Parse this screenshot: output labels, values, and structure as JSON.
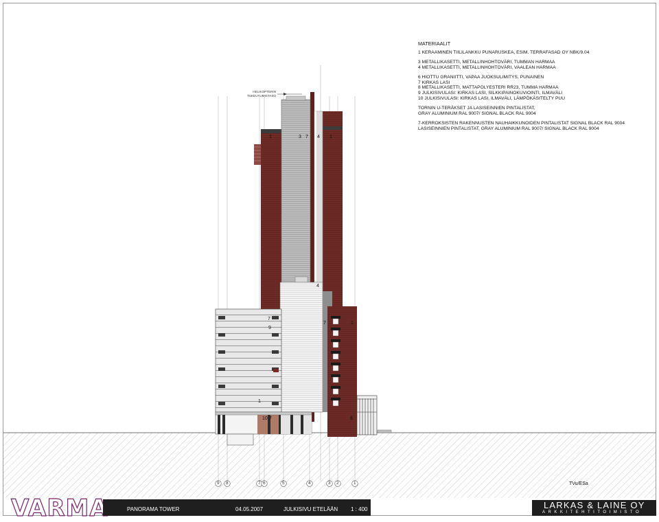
{
  "notes": {
    "title": "MATERIAALIT",
    "groups": [
      [
        "1   KERAAMINEN TIILILANKKU PUNARUSKEA, ESIM. TERRAFASAD OY NBK/9.04"
      ],
      [
        "3   METALLIKASETTI, METALLINHOHTOVÄRI, TUMMAN HARMAA",
        "4   METALLIKASETTI, METALLINHOHTOVÄRI, VAALEAN HARMAA"
      ],
      [
        "6   HIOTTU GRANIITTI, VAPAA JUOKSULIMITYS, PUNAINEN",
        "7   KIRKAS LASI",
        "8   METALLIKASETTI, MATTAPOLYESTERI RR23, TUMMA HARMAA",
        "9   JULKISIVULASI: KIRKAS LASI, SILKKIPAINOKUVIOINTI, ILMAVÄLI",
        "10 JULKISIVULASI: KIRKAS LASI,  ILMAVÄLI, LÄMPÖKÄSITELTY PUU"
      ],
      [
        "TORNIN U-TERÄKSET JA LASISEINNIEN PINTALISTAT,",
        "GRAY ALUMINIUM RAL 9007/ SIGNAL BLACK RAL 9004"
      ],
      [
        "7-KERROKSISTEN RAKENNUSTEN NAUHAIKKUNOIDEN PINTALISTAT SIGNAL BLACK RAL 9004",
        "LASISEINNIEN PINTALISTAT, GRAY ALUMINIUM RAL 9007/ SIGNAL BLACK RAL 9004"
      ]
    ]
  },
  "heli_label": [
    "HELIKOPTERIN",
    "TUKEUTUMISTASO"
  ],
  "callouts": {
    "top_1a": "1",
    "top_3": "3",
    "top_7": "7",
    "top_4": "4",
    "top_1b": "1",
    "mid_4": "4",
    "low_7a": "7",
    "low_9": "9",
    "low_7b": "7",
    "low_1": "1",
    "base_1": "1",
    "base_10": "10",
    "base_7": "7",
    "base_6": "6"
  },
  "grid_axes": [
    "9",
    "8",
    "7",
    "6",
    "5",
    "4",
    "3",
    "2",
    "1"
  ],
  "author": "TVu/ESa",
  "titleblock": {
    "logo": "VARMA",
    "project": "PANORAMA TOWER",
    "date": "04.05.2007",
    "sheet": "JULKISIVU ETELÄÄN",
    "scale": "1 : 400",
    "firm": "LARKAS & LAINE OY",
    "firm_sub": "ARKKITEHTITOIMISTO"
  },
  "colors": {
    "brick": "#6e2a25",
    "brick_dark": "#4e1c19",
    "metal_dark": "#9a9a9a",
    "metal_light": "#d2d2d2",
    "glass": "#f1f1f1",
    "granite": "#b07a68",
    "logo": "#7a1f6e",
    "titlebar": "#1f1f1f"
  }
}
